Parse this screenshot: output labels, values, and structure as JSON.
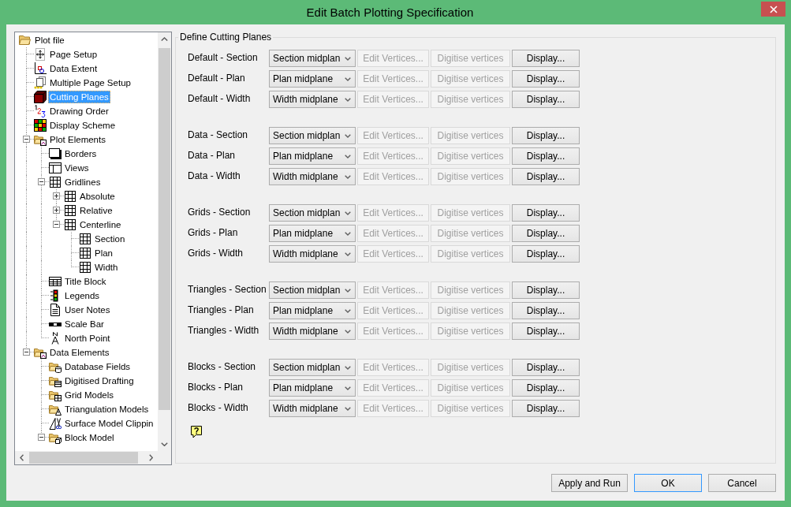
{
  "window": {
    "title": "Edit Batch Plotting Specification"
  },
  "tree": {
    "items": [
      {
        "label": "Plot file",
        "kind": "folder",
        "selected": false,
        "children": [
          {
            "label": "Page Setup",
            "kind": "pagesetup",
            "selected": false
          },
          {
            "label": "Data Extent",
            "kind": "extent",
            "selected": false
          },
          {
            "label": "Multiple Page Setup",
            "kind": "multipage",
            "selected": false
          },
          {
            "label": "Cutting Planes",
            "kind": "cube",
            "selected": true
          },
          {
            "label": "Drawing Order",
            "kind": "order",
            "selected": false
          },
          {
            "label": "Display Scheme",
            "kind": "scheme",
            "selected": false
          },
          {
            "label": "Plot Elements",
            "kind": "elements",
            "selected": false,
            "expanded": true,
            "children": [
              {
                "label": "Borders",
                "kind": "frame",
                "selected": false
              },
              {
                "label": "Views",
                "kind": "views",
                "selected": false
              },
              {
                "label": "Gridlines",
                "kind": "grid",
                "selected": false,
                "expanded": true,
                "children": [
                  {
                    "label": "Absolute",
                    "kind": "grid",
                    "selected": false,
                    "expanded": false
                  },
                  {
                    "label": "Relative",
                    "kind": "grid",
                    "selected": false,
                    "expanded": false
                  },
                  {
                    "label": "Centerline",
                    "kind": "grid",
                    "selected": false,
                    "expanded": true,
                    "children": [
                      {
                        "label": "Section",
                        "kind": "grid",
                        "selected": false
                      },
                      {
                        "label": "Plan",
                        "kind": "grid",
                        "selected": false
                      },
                      {
                        "label": "Width",
                        "kind": "grid",
                        "selected": false
                      }
                    ]
                  }
                ]
              },
              {
                "label": "Title Block",
                "kind": "titleblock",
                "selected": false
              },
              {
                "label": "Legends",
                "kind": "legend",
                "selected": false
              },
              {
                "label": "User Notes",
                "kind": "notes",
                "selected": false
              },
              {
                "label": "Scale Bar",
                "kind": "scalebar",
                "selected": false
              },
              {
                "label": "North Point",
                "kind": "north",
                "selected": false
              }
            ]
          },
          {
            "label": "Data Elements",
            "kind": "elements",
            "selected": false,
            "expanded": true,
            "children": [
              {
                "label": "Database Fields",
                "kind": "database",
                "selected": false
              },
              {
                "label": "Digitised Drafting",
                "kind": "drafting",
                "selected": false
              },
              {
                "label": "Grid Models",
                "kind": "gridmodel",
                "selected": false
              },
              {
                "label": "Triangulation Models",
                "kind": "triangles",
                "selected": false
              },
              {
                "label": "Surface Model Clippin",
                "kind": "clipping",
                "selected": false
              },
              {
                "label": "Block Model",
                "kind": "blockmodel",
                "selected": false,
                "expanded": true
              }
            ]
          }
        ]
      }
    ]
  },
  "cutting_planes": {
    "title": "Define Cutting Planes",
    "groups": [
      {
        "rows": [
          {
            "label": "Default - Section",
            "plane": "Section midplan",
            "buttons": [
              {
                "label": "Edit Vertices...",
                "disabled": true
              },
              {
                "label": "Digitise vertices",
                "disabled": true
              },
              {
                "label": "Display...",
                "disabled": false
              }
            ]
          },
          {
            "label": "Default - Plan",
            "plane": "Plan midplane",
            "buttons": [
              {
                "label": "Edit Vertices...",
                "disabled": true
              },
              {
                "label": "Digitise vertices",
                "disabled": true
              },
              {
                "label": "Display...",
                "disabled": false
              }
            ]
          },
          {
            "label": "Default - Width",
            "plane": "Width midplane",
            "buttons": [
              {
                "label": "Edit Vertices...",
                "disabled": true
              },
              {
                "label": "Digitise vertices",
                "disabled": true
              },
              {
                "label": "Display...",
                "disabled": false
              }
            ]
          }
        ]
      },
      {
        "rows": [
          {
            "label": "Data - Section",
            "plane": "Section midplan",
            "buttons": [
              {
                "label": "Edit Vertices...",
                "disabled": true
              },
              {
                "label": "Digitise vertices",
                "disabled": true
              },
              {
                "label": "Display...",
                "disabled": false
              }
            ]
          },
          {
            "label": "Data - Plan",
            "plane": "Plan midplane",
            "buttons": [
              {
                "label": "Edit Vertices...",
                "disabled": true
              },
              {
                "label": "Digitise vertices",
                "disabled": true
              },
              {
                "label": "Display...",
                "disabled": false
              }
            ]
          },
          {
            "label": "Data - Width",
            "plane": "Width midplane",
            "buttons": [
              {
                "label": "Edit Vertices...",
                "disabled": true
              },
              {
                "label": "Digitise vertices",
                "disabled": true
              },
              {
                "label": "Display...",
                "disabled": false
              }
            ]
          }
        ]
      },
      {
        "rows": [
          {
            "label": "Grids - Section",
            "plane": "Section midplan",
            "buttons": [
              {
                "label": "Edit Vertices...",
                "disabled": true
              },
              {
                "label": "Digitise vertices",
                "disabled": true
              },
              {
                "label": "Display...",
                "disabled": false
              }
            ]
          },
          {
            "label": "Grids - Plan",
            "plane": "Plan midplane",
            "buttons": [
              {
                "label": "Edit Vertices...",
                "disabled": true
              },
              {
                "label": "Digitise vertices",
                "disabled": true
              },
              {
                "label": "Display...",
                "disabled": false
              }
            ]
          },
          {
            "label": "Grids - Width",
            "plane": "Width midplane",
            "buttons": [
              {
                "label": "Edit Vertices...",
                "disabled": true
              },
              {
                "label": "Digitise vertices",
                "disabled": true
              },
              {
                "label": "Display...",
                "disabled": false
              }
            ]
          }
        ]
      },
      {
        "rows": [
          {
            "label": "Triangles - Section",
            "plane": "Section midplan",
            "buttons": [
              {
                "label": "Edit Vertices...",
                "disabled": true
              },
              {
                "label": "Digitise vertices",
                "disabled": true
              },
              {
                "label": "Display...",
                "disabled": false
              }
            ]
          },
          {
            "label": "Triangles - Plan",
            "plane": "Plan midplane",
            "buttons": [
              {
                "label": "Edit Vertices...",
                "disabled": true
              },
              {
                "label": "Digitise vertices",
                "disabled": true
              },
              {
                "label": "Display...",
                "disabled": false
              }
            ]
          },
          {
            "label": "Triangles - Width",
            "plane": "Width midplane",
            "buttons": [
              {
                "label": "Edit Vertices...",
                "disabled": true
              },
              {
                "label": "Digitise vertices",
                "disabled": true
              },
              {
                "label": "Display...",
                "disabled": false
              }
            ]
          }
        ]
      },
      {
        "rows": [
          {
            "label": "Blocks - Section",
            "plane": "Section midplan",
            "buttons": [
              {
                "label": "Edit Vertices...",
                "disabled": true
              },
              {
                "label": "Digitise vertices",
                "disabled": true
              },
              {
                "label": "Display...",
                "disabled": false
              }
            ]
          },
          {
            "label": "Blocks - Plan",
            "plane": "Plan midplane",
            "buttons": [
              {
                "label": "Edit Vertices...",
                "disabled": true
              },
              {
                "label": "Digitise vertices",
                "disabled": true
              },
              {
                "label": "Display...",
                "disabled": false
              }
            ]
          },
          {
            "label": "Blocks - Width",
            "plane": "Width midplane",
            "buttons": [
              {
                "label": "Edit Vertices...",
                "disabled": true
              },
              {
                "label": "Digitise vertices",
                "disabled": true
              },
              {
                "label": "Display...",
                "disabled": false
              }
            ]
          }
        ]
      }
    ]
  },
  "footer": {
    "buttons": [
      {
        "label": "Apply and Run",
        "default": false
      },
      {
        "label": "OK",
        "default": true
      },
      {
        "label": "Cancel",
        "default": false
      }
    ]
  }
}
